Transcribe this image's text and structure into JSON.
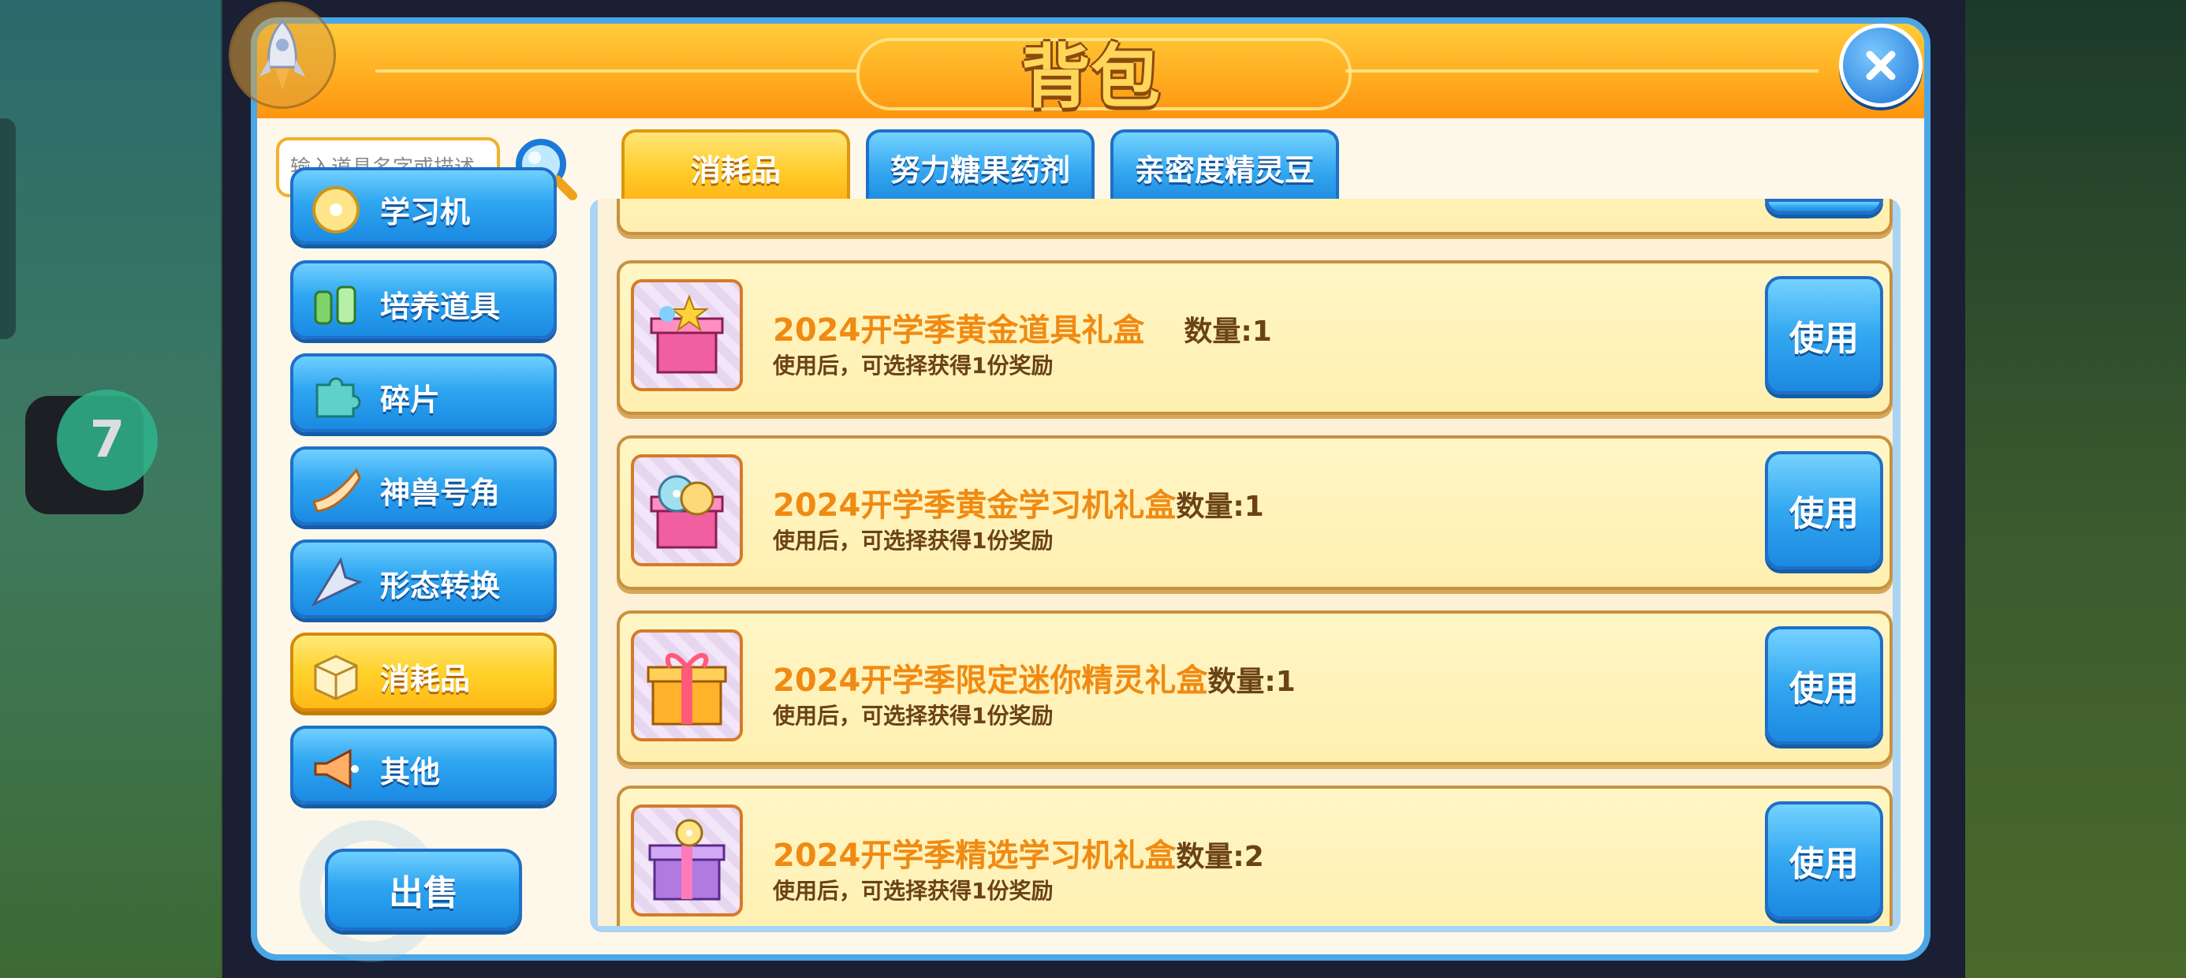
{
  "title": "背包",
  "search": {
    "placeholder": "输入道具名字或描述"
  },
  "sidebar": {
    "items": [
      {
        "label": "学习机",
        "icon": "disc-icon",
        "active": false
      },
      {
        "label": "培养道具",
        "icon": "potion-bottles-icon",
        "active": false
      },
      {
        "label": "碎片",
        "icon": "puzzle-piece-icon",
        "active": false
      },
      {
        "label": "神兽号角",
        "icon": "horn-icon",
        "active": false
      },
      {
        "label": "形态转换",
        "icon": "arrow-blade-icon",
        "active": false
      },
      {
        "label": "消耗品",
        "icon": "box-icon",
        "active": true
      },
      {
        "label": "其他",
        "icon": "megaphone-icon",
        "active": false
      }
    ],
    "sell_label": "出售"
  },
  "tabs": [
    {
      "label": "消耗品",
      "active": true
    },
    {
      "label": "努力糖果药剂",
      "active": false
    },
    {
      "label": "亲密度精灵豆",
      "active": false
    }
  ],
  "items": [
    {
      "name": "2024开学季黄金道具礼盒",
      "qty_label": "数量:1",
      "desc": "使用后，可选择获得1份奖励",
      "use_label": "使用",
      "icon": "gold-item-gift-box-icon"
    },
    {
      "name": "2024开学季黄金学习机礼盒",
      "qty_label": "数量:1",
      "desc": "使用后，可选择获得1份奖励",
      "use_label": "使用",
      "icon": "gold-disc-gift-box-icon"
    },
    {
      "name": "2024开学季限定迷你精灵礼盒",
      "qty_label": "数量:1",
      "desc": "使用后，可选择获得1份奖励",
      "use_label": "使用",
      "icon": "orange-gift-box-icon"
    },
    {
      "name": "2024开学季精选学习机礼盒",
      "qty_label": "数量:2",
      "desc": "使用后，可选择获得1份奖励",
      "use_label": "使用",
      "icon": "purple-gift-box-icon"
    }
  ],
  "overlay": {
    "app_badge_label": "7"
  },
  "colors": {
    "accent_blue": "#2fa6f1",
    "accent_yellow": "#ffd22a",
    "item_name": "#f08a12"
  }
}
